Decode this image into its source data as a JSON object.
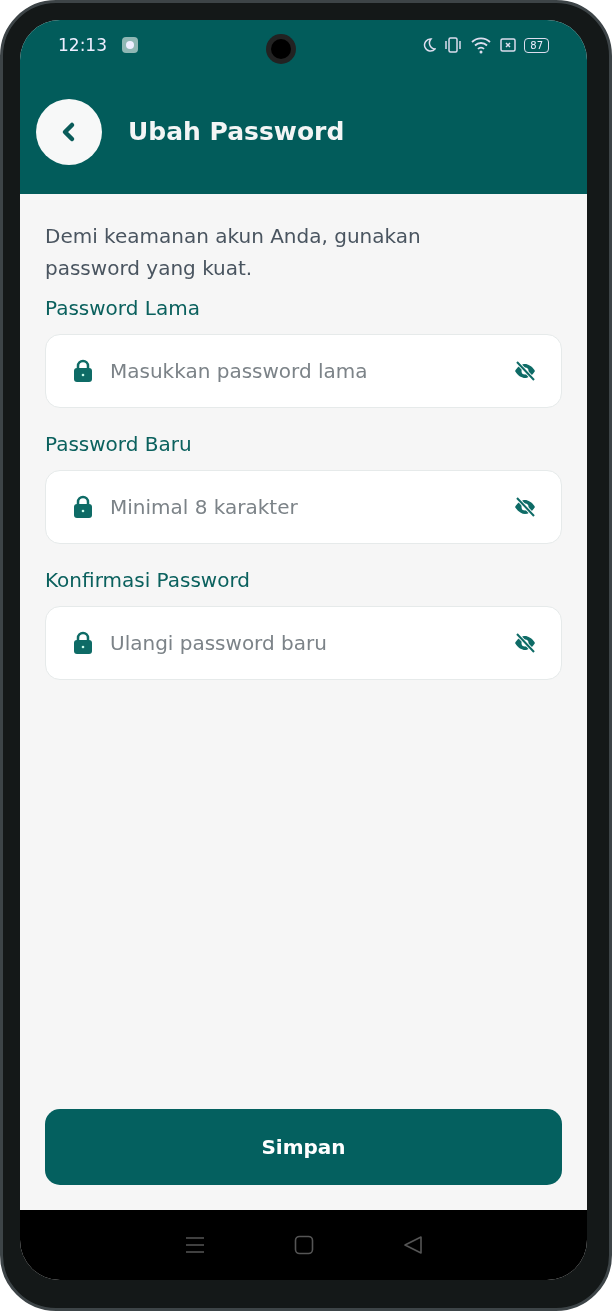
{
  "status_bar": {
    "time": "12:13",
    "battery": "87"
  },
  "header": {
    "title": "Ubah Password"
  },
  "intro": "Demi keamanan akun Anda, gunakan password yang kuat.",
  "fields": [
    {
      "label": "Password Lama",
      "placeholder": "Masukkan password lama"
    },
    {
      "label": "Password Baru",
      "placeholder": "Minimal 8 karakter"
    },
    {
      "label": "Konfirmasi Password",
      "placeholder": "Ulangi password baru"
    }
  ],
  "button": "Simpan"
}
